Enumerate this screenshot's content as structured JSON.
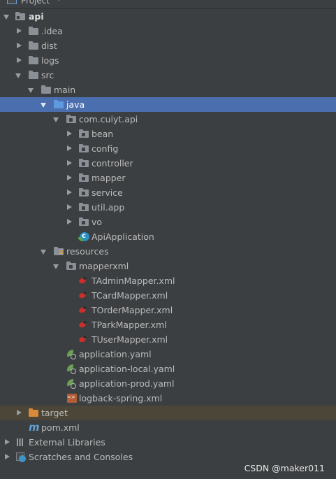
{
  "header": {
    "title": "Project"
  },
  "tree": [
    {
      "label": "api",
      "bold": true,
      "arrow": "down",
      "icon": "project-folder-icon"
    },
    {
      "label": ".idea",
      "arrow": "right",
      "icon": "folder-icon"
    },
    {
      "label": "dist",
      "arrow": "right",
      "icon": "folder-icon"
    },
    {
      "label": "logs",
      "arrow": "right",
      "icon": "folder-icon"
    },
    {
      "label": "src",
      "arrow": "down",
      "icon": "folder-icon"
    },
    {
      "label": "main",
      "arrow": "down",
      "icon": "folder-icon"
    },
    {
      "label": "java",
      "arrow": "down",
      "icon": "source-folder-icon",
      "selected": true
    },
    {
      "label": "com.cuiyt.api",
      "arrow": "down",
      "icon": "package-icon"
    },
    {
      "label": "bean",
      "arrow": "right",
      "icon": "package-icon"
    },
    {
      "label": "config",
      "arrow": "right",
      "icon": "package-icon"
    },
    {
      "label": "controller",
      "arrow": "right",
      "icon": "package-icon"
    },
    {
      "label": "mapper",
      "arrow": "right",
      "icon": "package-icon"
    },
    {
      "label": "service",
      "arrow": "right",
      "icon": "package-icon"
    },
    {
      "label": "util.app",
      "arrow": "right",
      "icon": "package-icon"
    },
    {
      "label": "vo",
      "arrow": "right",
      "icon": "package-icon"
    },
    {
      "label": "ApiApplication",
      "icon": "spring-boot-class-icon"
    },
    {
      "label": "resources",
      "arrow": "down",
      "icon": "resources-folder-icon"
    },
    {
      "label": "mapperxml",
      "arrow": "down",
      "icon": "package-icon"
    },
    {
      "label": "TAdminMapper.xml",
      "icon": "mybatis-xml-icon"
    },
    {
      "label": "TCardMapper.xml",
      "icon": "mybatis-xml-icon"
    },
    {
      "label": "TOrderMapper.xml",
      "icon": "mybatis-xml-icon"
    },
    {
      "label": "TParkMapper.xml",
      "icon": "mybatis-xml-icon"
    },
    {
      "label": "TUserMapper.xml",
      "icon": "mybatis-xml-icon"
    },
    {
      "label": "application.yaml",
      "icon": "spring-yaml-icon"
    },
    {
      "label": "application-local.yaml",
      "icon": "spring-yaml-icon"
    },
    {
      "label": "application-prod.yaml",
      "icon": "spring-yaml-icon"
    },
    {
      "label": "logback-spring.xml",
      "icon": "xml-file-icon"
    },
    {
      "label": "target",
      "arrow": "right",
      "icon": "excluded-folder-icon",
      "excluded": true
    },
    {
      "label": "pom.xml",
      "icon": "maven-icon"
    },
    {
      "label": "External Libraries",
      "arrow": "right",
      "icon": "libraries-icon"
    },
    {
      "label": "Scratches and Consoles",
      "arrow": "right",
      "icon": "scratches-icon"
    }
  ],
  "watermark": "CSDN @maker011",
  "colors": {
    "background": "#3c3f41",
    "selection": "#4b6eaf",
    "excluded_row": "#4c4638",
    "text": "#bbbbbb"
  }
}
